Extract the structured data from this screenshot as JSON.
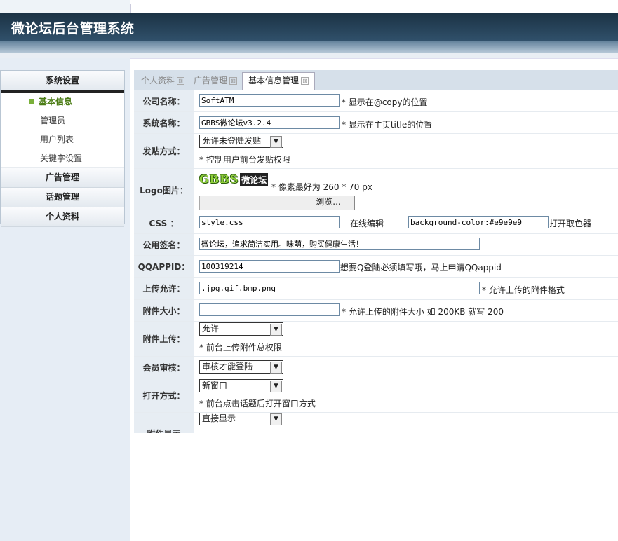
{
  "app": {
    "title": "微论坛后台管理系统"
  },
  "sidebar": {
    "sections": [
      {
        "label": "系统设置",
        "items": [
          {
            "label": "基本信息",
            "active": true
          },
          {
            "label": "管理员"
          },
          {
            "label": "用户列表"
          },
          {
            "label": "关键字设置"
          }
        ]
      },
      {
        "label": "广告管理"
      },
      {
        "label": "话题管理"
      },
      {
        "label": "个人资料"
      }
    ]
  },
  "tabs": [
    {
      "label": "个人资料",
      "close": "⊠"
    },
    {
      "label": "广告管理",
      "close": "⊠"
    },
    {
      "label": "基本信息管理",
      "close": "⊠",
      "active": true
    }
  ],
  "form": {
    "company": {
      "label": "公司名称：",
      "value": "SoftATM",
      "hint": "* 显示在@copy的位置"
    },
    "sysname": {
      "label": "系统名称：",
      "value": "GBBS微论坛v3.2.4",
      "hint": "* 显示在主页title的位置"
    },
    "post": {
      "label": "发贴方式：",
      "value": "允许未登陆发贴",
      "hint": "* 控制用户前台发贴权限"
    },
    "logo": {
      "label": "Logo图片：",
      "logo_text": "GBBS",
      "logo_badge": "微论坛",
      "hint": "* 像素最好为 260 * 70 px",
      "browse": "浏览..."
    },
    "css": {
      "label": "CSS ：",
      "value": "style.css",
      "edit_label": "在线编辑",
      "color_value": "background-color:#e9e9e9",
      "picker_label": "打开取色器"
    },
    "sign": {
      "label": "公用签名：",
      "value": "微论坛，追求简洁实用。味萌，购买健康生活！"
    },
    "qq": {
      "label": "QQAPPID：",
      "value": "100319214",
      "hint": "想要Q登陆必须填写哦，马上申请QQappid"
    },
    "upload_allow": {
      "label": "上传允许：",
      "value": ".jpg.gif.bmp.png",
      "hint": "* 允许上传的附件格式"
    },
    "att_size": {
      "label": "附件大小：",
      "value": "",
      "hint": "* 允许上传的附件大小 如 200KB 就写 200"
    },
    "att_upload": {
      "label": "附件上传：",
      "value": "允许",
      "hint": "* 前台上传附件总权限"
    },
    "member": {
      "label": "会员审核：",
      "value": "审核才能登陆"
    },
    "open": {
      "label": "打开方式：",
      "value": "新窗口",
      "hint": "* 前台点击话题后打开窗口方式"
    },
    "att_show": {
      "label": "附件显示",
      "value": "直接显示"
    }
  }
}
